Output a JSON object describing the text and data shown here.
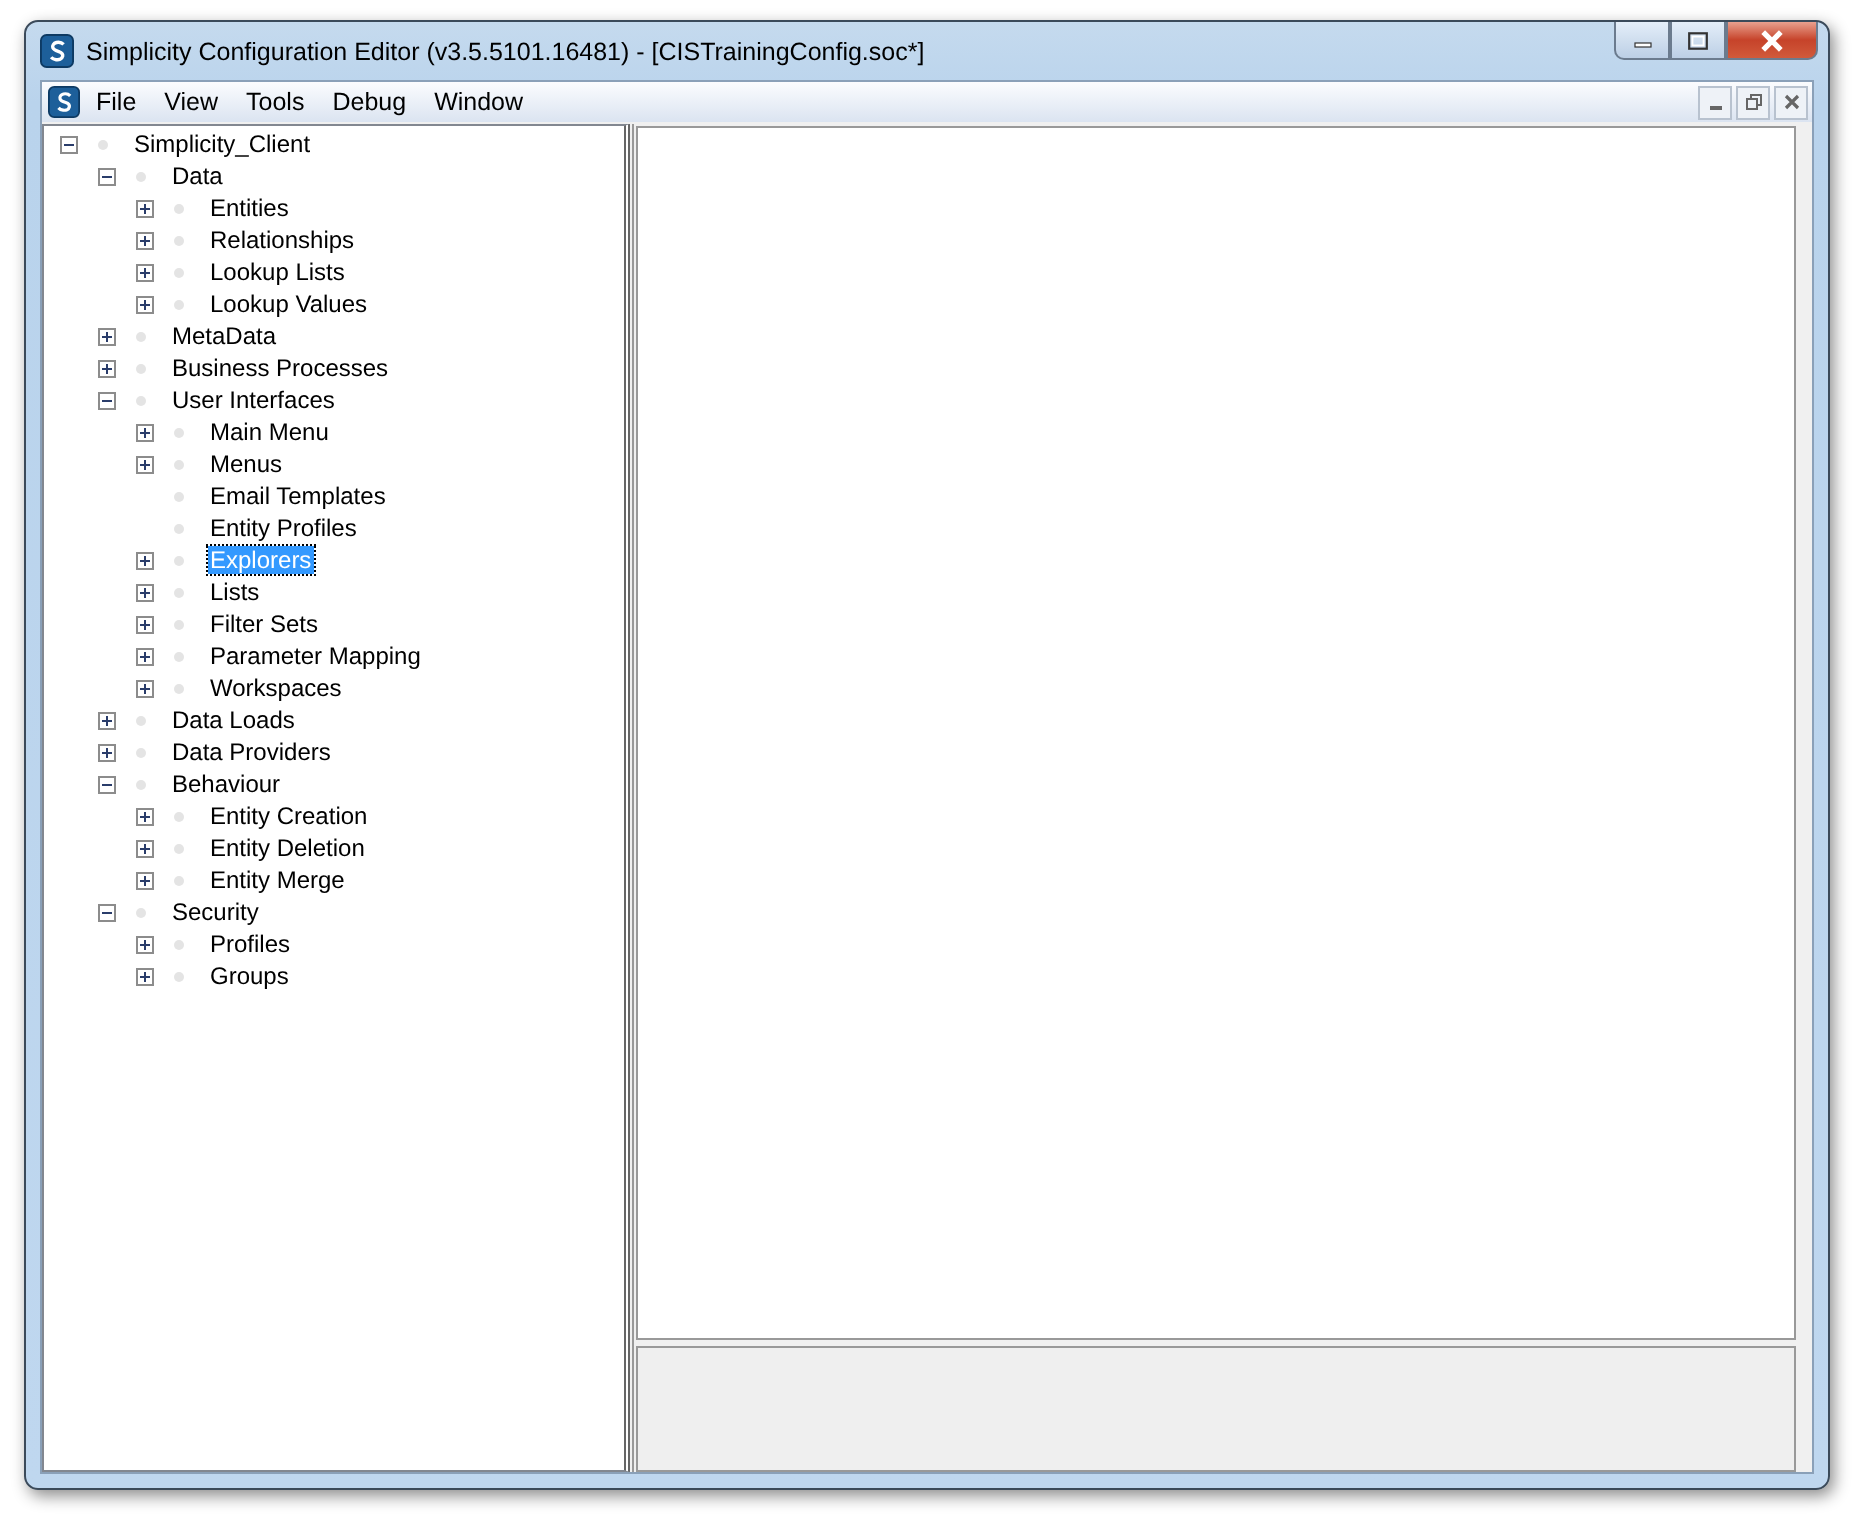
{
  "window": {
    "title": "Simplicity Configuration Editor (v3.5.5101.16481) - [CISTrainingConfig.soc*]"
  },
  "menu": [
    "File",
    "View",
    "Tools",
    "Debug",
    "Window"
  ],
  "tree": [
    {
      "label": "Simplicity_Client",
      "kind": "branch",
      "expanded": true,
      "selected": false,
      "children": [
        {
          "label": "Data",
          "kind": "branch",
          "expanded": true,
          "selected": false,
          "children": [
            {
              "label": "Entities",
              "kind": "branch",
              "expanded": false,
              "selected": false
            },
            {
              "label": "Relationships",
              "kind": "branch",
              "expanded": false,
              "selected": false
            },
            {
              "label": "Lookup Lists",
              "kind": "branch",
              "expanded": false,
              "selected": false
            },
            {
              "label": "Lookup Values",
              "kind": "branch",
              "expanded": false,
              "selected": false
            }
          ]
        },
        {
          "label": "MetaData",
          "kind": "branch",
          "expanded": false,
          "selected": false
        },
        {
          "label": "Business Processes",
          "kind": "branch",
          "expanded": false,
          "selected": false
        },
        {
          "label": "User Interfaces",
          "kind": "branch",
          "expanded": true,
          "selected": false,
          "children": [
            {
              "label": "Main Menu",
              "kind": "branch",
              "expanded": false,
              "selected": false
            },
            {
              "label": "Menus",
              "kind": "branch",
              "expanded": false,
              "selected": false
            },
            {
              "label": "Email Templates",
              "kind": "leaf",
              "selected": false
            },
            {
              "label": "Entity Profiles",
              "kind": "leaf",
              "selected": false
            },
            {
              "label": "Explorers",
              "kind": "branch",
              "expanded": false,
              "selected": true
            },
            {
              "label": "Lists",
              "kind": "branch",
              "expanded": false,
              "selected": false
            },
            {
              "label": "Filter Sets",
              "kind": "branch",
              "expanded": false,
              "selected": false
            },
            {
              "label": "Parameter Mapping",
              "kind": "branch",
              "expanded": false,
              "selected": false
            },
            {
              "label": "Workspaces",
              "kind": "branch",
              "expanded": false,
              "selected": false
            }
          ]
        },
        {
          "label": "Data Loads",
          "kind": "branch",
          "expanded": false,
          "selected": false
        },
        {
          "label": "Data Providers",
          "kind": "branch",
          "expanded": false,
          "selected": false
        },
        {
          "label": "Behaviour",
          "kind": "branch",
          "expanded": true,
          "selected": false,
          "children": [
            {
              "label": "Entity Creation",
              "kind": "branch",
              "expanded": false,
              "selected": false
            },
            {
              "label": "Entity Deletion",
              "kind": "branch",
              "expanded": false,
              "selected": false
            },
            {
              "label": "Entity Merge",
              "kind": "branch",
              "expanded": false,
              "selected": false
            }
          ]
        },
        {
          "label": "Security",
          "kind": "branch",
          "expanded": true,
          "selected": false,
          "children": [
            {
              "label": "Profiles",
              "kind": "branch",
              "expanded": false,
              "selected": false
            },
            {
              "label": "Groups",
              "kind": "branch",
              "expanded": false,
              "selected": false
            }
          ]
        }
      ]
    }
  ]
}
